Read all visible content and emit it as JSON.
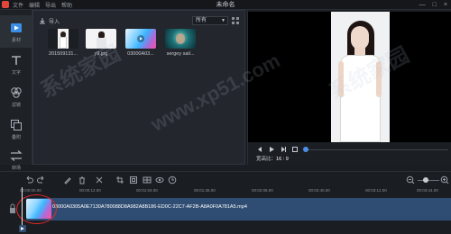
{
  "app": {
    "menu": [
      "文件",
      "编辑",
      "导出",
      "帮助"
    ],
    "title": "未命名",
    "window_buttons": [
      "—",
      "□",
      "×"
    ]
  },
  "sidebar": {
    "items": [
      {
        "label": "素材",
        "icon": "media-icon",
        "active": true
      },
      {
        "label": "文字",
        "icon": "text-icon",
        "active": false
      },
      {
        "label": "滤镜",
        "icon": "filter-icon",
        "active": false
      },
      {
        "label": "叠附",
        "icon": "overlay-icon",
        "active": false
      },
      {
        "label": "转场",
        "icon": "transition-icon",
        "active": false
      }
    ]
  },
  "library": {
    "import_label": "导入",
    "filter_value": "所有",
    "items": [
      {
        "name": "201509131...",
        "type": "image"
      },
      {
        "name": "y9.jpg",
        "type": "image"
      },
      {
        "name": "03000A03...",
        "type": "video"
      },
      {
        "name": "sergey sail...",
        "type": "image"
      }
    ]
  },
  "preview": {
    "ratio_label": "宽高比：",
    "ratio_value": "16 : 9",
    "progress": 0.0
  },
  "timeline": {
    "ticks": [
      "00:00:00.00",
      "00:00:12.00",
      "00:01:04.00",
      "00:01:36.00",
      "00:02:08.00",
      "00:02:40.00",
      "00:03:12.00",
      "00:03:44.00"
    ],
    "clip_label": "03000A0305A0E7130A780088D8A982A8B186-ED0C-22C7-AF2B-A8A0F0A781A5.mp4"
  },
  "watermark": [
    "系统家园",
    "www.xp51.com",
    "系统家园"
  ],
  "colors": {
    "accent": "#4a8fe8",
    "track": "#2f4d73",
    "highlight_circle": "#e02828"
  }
}
